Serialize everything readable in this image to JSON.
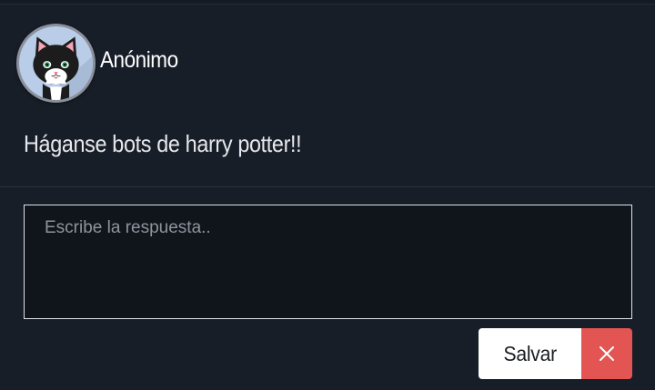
{
  "post": {
    "author": "Anónimo",
    "avatar_icon": "cat-avatar-icon",
    "text": "Háganse bots de harry potter!!"
  },
  "reply": {
    "placeholder": "Escribe la respuesta..",
    "value": ""
  },
  "actions": {
    "save_label": "Salvar",
    "cancel_icon": "close-icon"
  },
  "colors": {
    "background": "#181e28",
    "cancel": "#e25552",
    "save": "#ffffff"
  }
}
